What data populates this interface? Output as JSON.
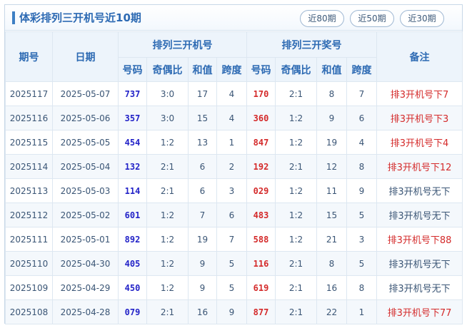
{
  "header": {
    "title": "体彩排列三开机号近10期",
    "buttons": [
      "近80期",
      "近50期",
      "近30期"
    ]
  },
  "columns": {
    "period": "期号",
    "date": "日期",
    "kaiji_group": "排列三开机号",
    "jiang_group": "排列三开奖号",
    "note": "备注",
    "sub": [
      "号码",
      "奇偶比",
      "和值",
      "跨度"
    ]
  },
  "rows": [
    {
      "period": "2025117",
      "date": "2025-05-07",
      "kj": {
        "num": "737",
        "oe": "3:0",
        "sum": "17",
        "span": "4"
      },
      "jh": {
        "num": "170",
        "oe": "2:1",
        "sum": "8",
        "span": "7"
      },
      "note": "排3开机号下7",
      "hit": true
    },
    {
      "period": "2025116",
      "date": "2025-05-06",
      "kj": {
        "num": "357",
        "oe": "3:0",
        "sum": "15",
        "span": "4"
      },
      "jh": {
        "num": "360",
        "oe": "1:2",
        "sum": "9",
        "span": "6"
      },
      "note": "排3开机号下3",
      "hit": true
    },
    {
      "period": "2025115",
      "date": "2025-05-05",
      "kj": {
        "num": "454",
        "oe": "1:2",
        "sum": "13",
        "span": "1"
      },
      "jh": {
        "num": "847",
        "oe": "1:2",
        "sum": "19",
        "span": "4"
      },
      "note": "排3开机号下4",
      "hit": true
    },
    {
      "period": "2025114",
      "date": "2025-05-04",
      "kj": {
        "num": "132",
        "oe": "2:1",
        "sum": "6",
        "span": "2"
      },
      "jh": {
        "num": "192",
        "oe": "2:1",
        "sum": "12",
        "span": "8"
      },
      "note": "排3开机号下12",
      "hit": true
    },
    {
      "period": "2025113",
      "date": "2025-05-03",
      "kj": {
        "num": "114",
        "oe": "2:1",
        "sum": "6",
        "span": "3"
      },
      "jh": {
        "num": "029",
        "oe": "1:2",
        "sum": "11",
        "span": "9"
      },
      "note": "排3开机号无下",
      "hit": false
    },
    {
      "period": "2025112",
      "date": "2025-05-02",
      "kj": {
        "num": "601",
        "oe": "1:2",
        "sum": "7",
        "span": "6"
      },
      "jh": {
        "num": "483",
        "oe": "1:2",
        "sum": "15",
        "span": "5"
      },
      "note": "排3开机号无下",
      "hit": false
    },
    {
      "period": "2025111",
      "date": "2025-05-01",
      "kj": {
        "num": "892",
        "oe": "1:2",
        "sum": "19",
        "span": "7"
      },
      "jh": {
        "num": "588",
        "oe": "1:2",
        "sum": "21",
        "span": "3"
      },
      "note": "排3开机号下88",
      "hit": true
    },
    {
      "period": "2025110",
      "date": "2025-04-30",
      "kj": {
        "num": "405",
        "oe": "1:2",
        "sum": "9",
        "span": "5"
      },
      "jh": {
        "num": "116",
        "oe": "2:1",
        "sum": "8",
        "span": "5"
      },
      "note": "排3开机号无下",
      "hit": false
    },
    {
      "period": "2025109",
      "date": "2025-04-29",
      "kj": {
        "num": "450",
        "oe": "1:2",
        "sum": "9",
        "span": "5"
      },
      "jh": {
        "num": "619",
        "oe": "2:1",
        "sum": "16",
        "span": "8"
      },
      "note": "排3开机号无下",
      "hit": false
    },
    {
      "period": "2025108",
      "date": "2025-04-28",
      "kj": {
        "num": "079",
        "oe": "2:1",
        "sum": "16",
        "span": "9"
      },
      "jh": {
        "num": "877",
        "oe": "2:1",
        "sum": "22",
        "span": "1"
      },
      "note": "排3开机号下77",
      "hit": true
    }
  ],
  "colors": {
    "accent": "#2d6ab3",
    "kaiji_number": "#2323c8",
    "kaijiang_number": "#d42a2a",
    "note_hit": "#d42a2a",
    "note_miss": "#3a5575"
  }
}
